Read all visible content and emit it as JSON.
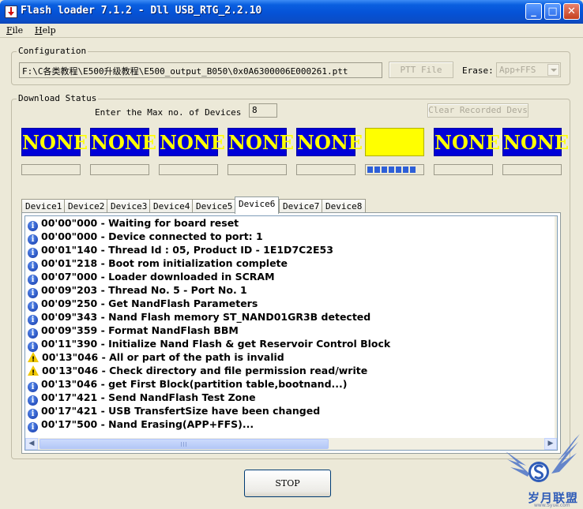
{
  "window": {
    "title": "Flash loader 7.1.2 - Dll USB_RTG_2.2.10",
    "controls": {
      "minimize": "_",
      "maximize": "□",
      "close": "✕"
    }
  },
  "menu": {
    "file": "File",
    "help": "Help"
  },
  "configuration": {
    "group_title": "Configuration",
    "path": "F:\\C各类教程\\E500升级教程\\E500_output_B050\\0x0A6300006E000261.ptt",
    "ptt_button": "PTT File",
    "erase_label": "Erase:",
    "erase_value": "App+FFS"
  },
  "download_status": {
    "group_title": "Download Status",
    "max_label": "Enter the Max no. of Devices",
    "max_value": "8",
    "clear_button": "Clear Recorded Devs",
    "devices": [
      {
        "label": "NONE",
        "progress": 0
      },
      {
        "label": "NONE",
        "progress": 0
      },
      {
        "label": "NONE",
        "progress": 0
      },
      {
        "label": "NONE",
        "progress": 0
      },
      {
        "label": "NONE",
        "progress": 0
      },
      {
        "label": "",
        "progress": 0.9,
        "color": "#ffff00"
      },
      {
        "label": "NONE",
        "progress": 0
      },
      {
        "label": "NONE",
        "progress": 0
      }
    ]
  },
  "tabs": [
    "Device1",
    "Device2",
    "Device3",
    "Device4",
    "Device5",
    "Device6",
    "Device7",
    "Device8"
  ],
  "active_tab": "Device6",
  "log": [
    {
      "icon": "info",
      "text": "00'00\"000 - Waiting for board reset"
    },
    {
      "icon": "info",
      "text": "00'00\"000 - Device connected to port: 1"
    },
    {
      "icon": "info",
      "text": "00'01\"140 - Thread Id : 05, Product ID - 1E1D7C2E53"
    },
    {
      "icon": "info",
      "text": "00'01\"218 - Boot rom initialization complete"
    },
    {
      "icon": "info",
      "text": "00'07\"000 - Loader downloaded in SCRAM"
    },
    {
      "icon": "info",
      "text": "00'09\"203 - Thread No.  5  - Port No. 1"
    },
    {
      "icon": "info",
      "text": "00'09\"250 - Get NandFlash Parameters"
    },
    {
      "icon": "info",
      "text": "00'09\"343 - Nand Flash memory ST_NAND01GR3B detected"
    },
    {
      "icon": "info",
      "text": "00'09\"359 - Format NandFlash BBM"
    },
    {
      "icon": "info",
      "text": "00'11\"390 - Initialize Nand Flash & get Reservoir Control Block"
    },
    {
      "icon": "warning",
      "text": "00'13\"046 - All or part of the path is invalid"
    },
    {
      "icon": "warning",
      "text": "00'13\"046 - Check directory and file permission read/write"
    },
    {
      "icon": "info",
      "text": "00'13\"046 - get First Block(partition table,bootnand...)"
    },
    {
      "icon": "info",
      "text": "00'17\"421 - Send NandFlash Test Zone"
    },
    {
      "icon": "info",
      "text": "00'17\"421 - USB TransfertSize have been changed"
    },
    {
      "icon": "info",
      "text": "00'17\"500 - Nand Erasing(APP+FFS)..."
    }
  ],
  "stop_button": "STOP",
  "watermark": {
    "text": "岁月联盟",
    "sub": "www.Syue.com"
  }
}
